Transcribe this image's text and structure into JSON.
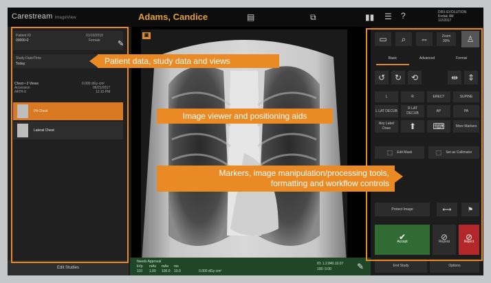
{
  "app": {
    "brand": "Carestream",
    "brand_sub": "ImageView"
  },
  "header": {
    "patient_name": "Adams, Candice",
    "info_lines": [
      "DRX-EVOLUTION",
      "Kodak 4M",
      "1/2/2017"
    ]
  },
  "patient_panel": {
    "patient_id_label": "Patient ID",
    "patient_id": "00000-0",
    "dob": "01/10/2010",
    "sex": "Female",
    "study_date_label": "Study Date/Time",
    "study_date": "Today",
    "exam_title": "Chest • 2 Views",
    "exam_dose": "0.000 dGy·cm²",
    "accession_label": "Accession",
    "accession": "#ATH-0",
    "accession_date": "06/21/2017",
    "accession_time": "12:15 PM",
    "views": [
      {
        "label": "PA Chest",
        "selected": true
      },
      {
        "label": "Lateral Chest",
        "selected": false
      }
    ],
    "edit_studies": "Edit Studies"
  },
  "image_footer": {
    "status": "Needs Approval",
    "labels": [
      "kVp",
      "mAs",
      "mAs",
      "ms"
    ],
    "values": [
      "110",
      "1.00",
      "100.0",
      "10.0"
    ],
    "dose": "0.000 dGy·cm²",
    "id_left": "ID: 1.2.840.10.07",
    "id_right": "100: 0.00"
  },
  "tools": {
    "zoom_label": "Zoom",
    "zoom_value": "90%",
    "tabs": [
      "Basic",
      "Advanced",
      "Format"
    ],
    "markers": [
      "L",
      "R",
      "ERECT",
      "SUPINE",
      "L LAT DECUB",
      "R LAT DECUB",
      "AP",
      "PA"
    ],
    "any_label": "Any Label Draw",
    "more_markers": "More Markers",
    "edit_mask": "Edit Mask",
    "set_collimator": "Set as Collimator",
    "protect_image": "Protect Image",
    "accept": "Accept",
    "repeat": "Repeat",
    "reject": "Reject",
    "end_study": "End Study",
    "options": "Options"
  },
  "annotations": {
    "patient": "Patient data, study data and views",
    "viewer": "Image viewer and positioning aids",
    "tools_line1": "Markers, image manipulation/processing tools,",
    "tools_line2": "formatting and workflow controls"
  },
  "colors": {
    "accent": "#ea8a25",
    "accept": "#2f6b33",
    "reject": "#b3262a",
    "footer": "#1f4727"
  }
}
